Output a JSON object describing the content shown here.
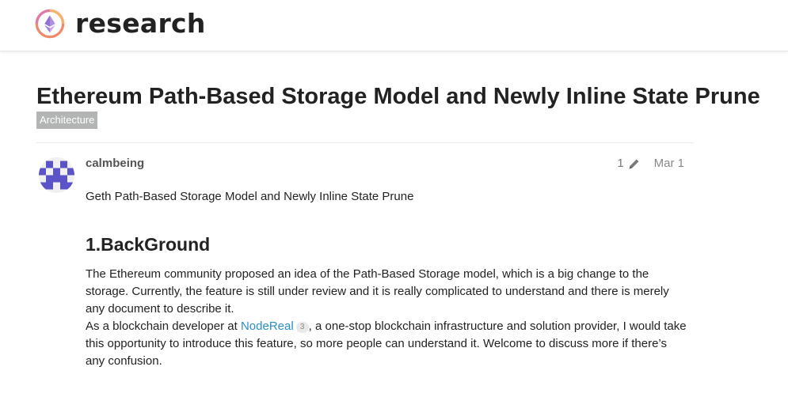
{
  "site": {
    "name": "research",
    "logo_icon": "ethereum-research-logo-icon"
  },
  "topic": {
    "title": "Ethereum Path-Based Storage Model and Newly Inline State Prune",
    "category": "Architecture",
    "category_color": "#b3b5b4"
  },
  "post": {
    "username": "calmbeing",
    "edit_count": "1",
    "edit_icon": "pencil-icon",
    "date": "Mar 1",
    "intro": "Geth Path-Based Storage Model and Newly Inline State Prune",
    "heading": "1.BackGround",
    "paragraph1": "The Ethereum community proposed an idea of the Path-Based Storage model, which is a big change to the storage. Currently, the feature is still under review and it is really complicated to understand and there is merely any document to describe it.",
    "paragraph2_before": "As a blockchain developer at ",
    "paragraph2_link": "NodeReal",
    "paragraph2_link_clicks": "3",
    "paragraph2_after": ", a one-stop blockchain infrastructure and solution provider, I would take this opportunity to introduce this feature, so more people can understand it. Welcome to discuss more if there’s any confusion."
  },
  "colors": {
    "link": "#2a8ec7",
    "avatar": "#5b54c9",
    "text": "#222222",
    "muted": "#888888"
  }
}
